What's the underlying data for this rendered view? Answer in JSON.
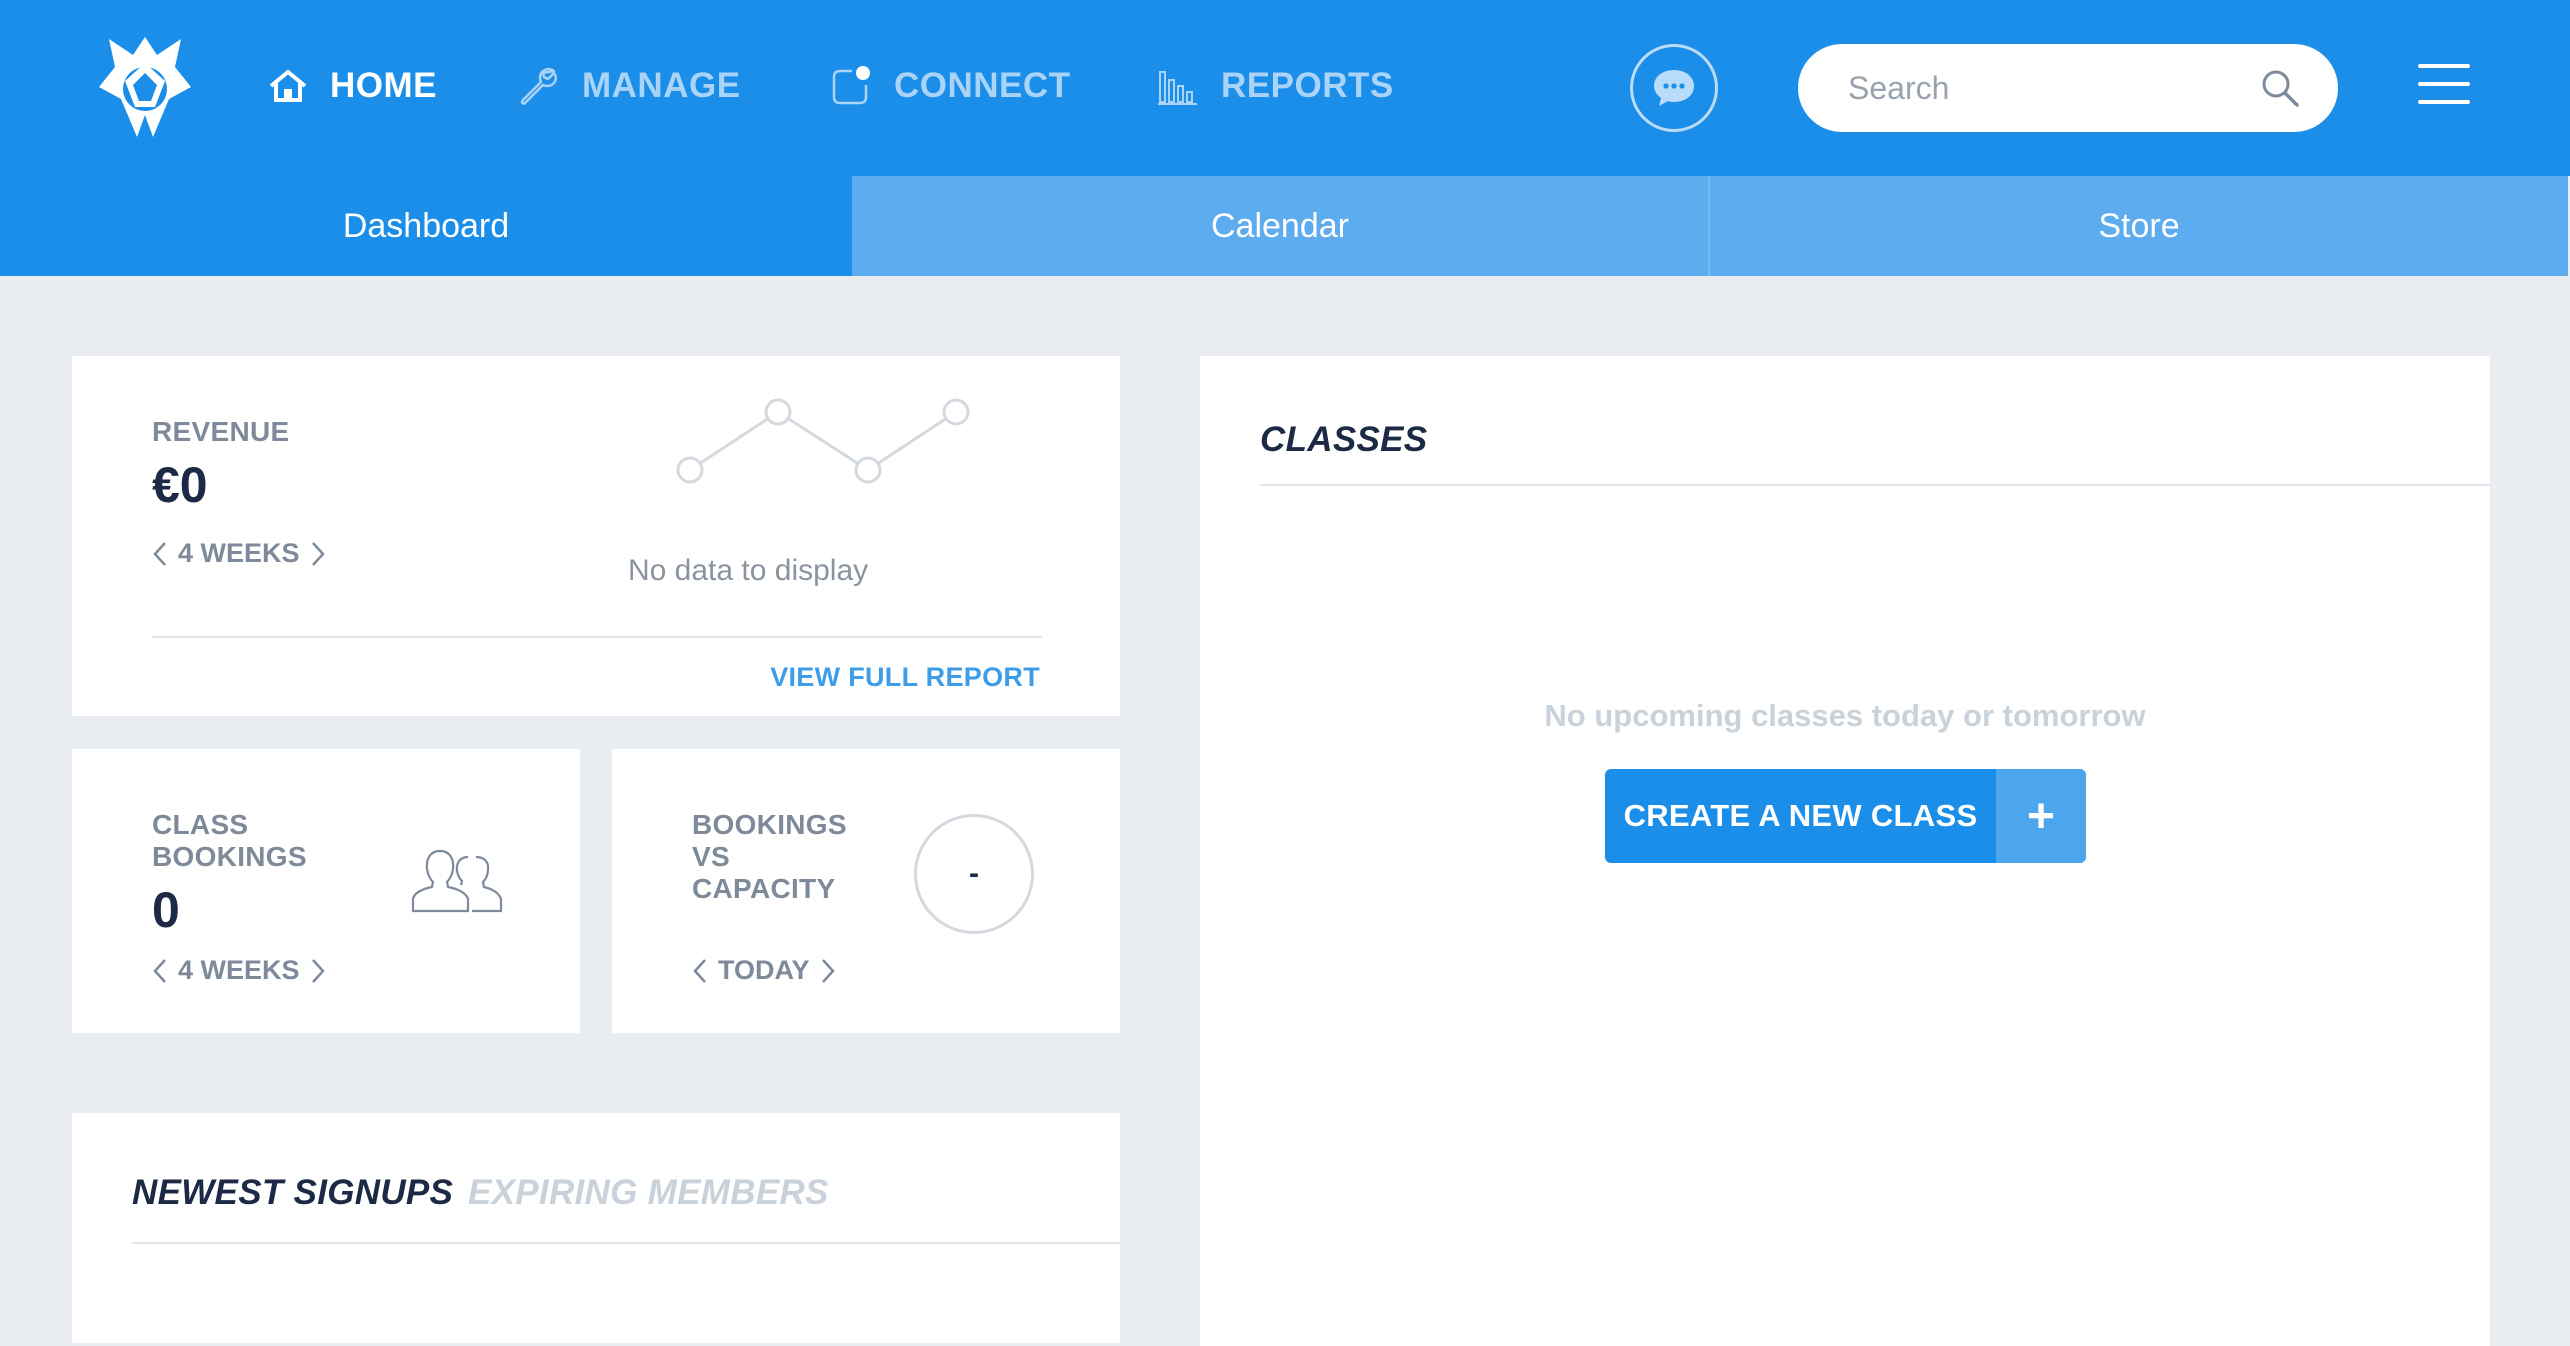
{
  "nav": {
    "items": [
      {
        "label": "HOME",
        "icon": "home-icon",
        "active": true
      },
      {
        "label": "MANAGE",
        "icon": "wrench-icon",
        "active": false
      },
      {
        "label": "CONNECT",
        "icon": "notification-icon",
        "active": false
      },
      {
        "label": "REPORTS",
        "icon": "bar-chart-icon",
        "active": false
      }
    ],
    "search_placeholder": "Search"
  },
  "subtabs": [
    {
      "label": "Dashboard",
      "active": true
    },
    {
      "label": "Calendar",
      "active": false
    },
    {
      "label": "Store",
      "active": false
    }
  ],
  "revenue": {
    "label": "REVENUE",
    "value": "€0",
    "period": "4 WEEKS",
    "chart_empty_text": "No data to display",
    "view_report_label": "VIEW FULL REPORT"
  },
  "class_bookings": {
    "label_line1": "CLASS",
    "label_line2": "BOOKINGS",
    "value": "0",
    "period": "4 WEEKS",
    "icon": "users-icon"
  },
  "capacity": {
    "label_line1": "BOOKINGS",
    "label_line2": "VS",
    "label_line3": "CAPACITY",
    "value": "-",
    "period": "TODAY"
  },
  "signups": {
    "tab_active": "NEWEST SIGNUPS",
    "tab_inactive": "EXPIRING MEMBERS"
  },
  "classes": {
    "title": "CLASSES",
    "empty_message": "No upcoming classes today or tomorrow",
    "create_label": "CREATE A NEW CLASS",
    "create_plus": "+"
  },
  "colors": {
    "brand_blue": "#1a8ee8",
    "inactive_tab": "#5dacef",
    "navy_text": "#1c2a45",
    "background": "#e9edf1"
  }
}
